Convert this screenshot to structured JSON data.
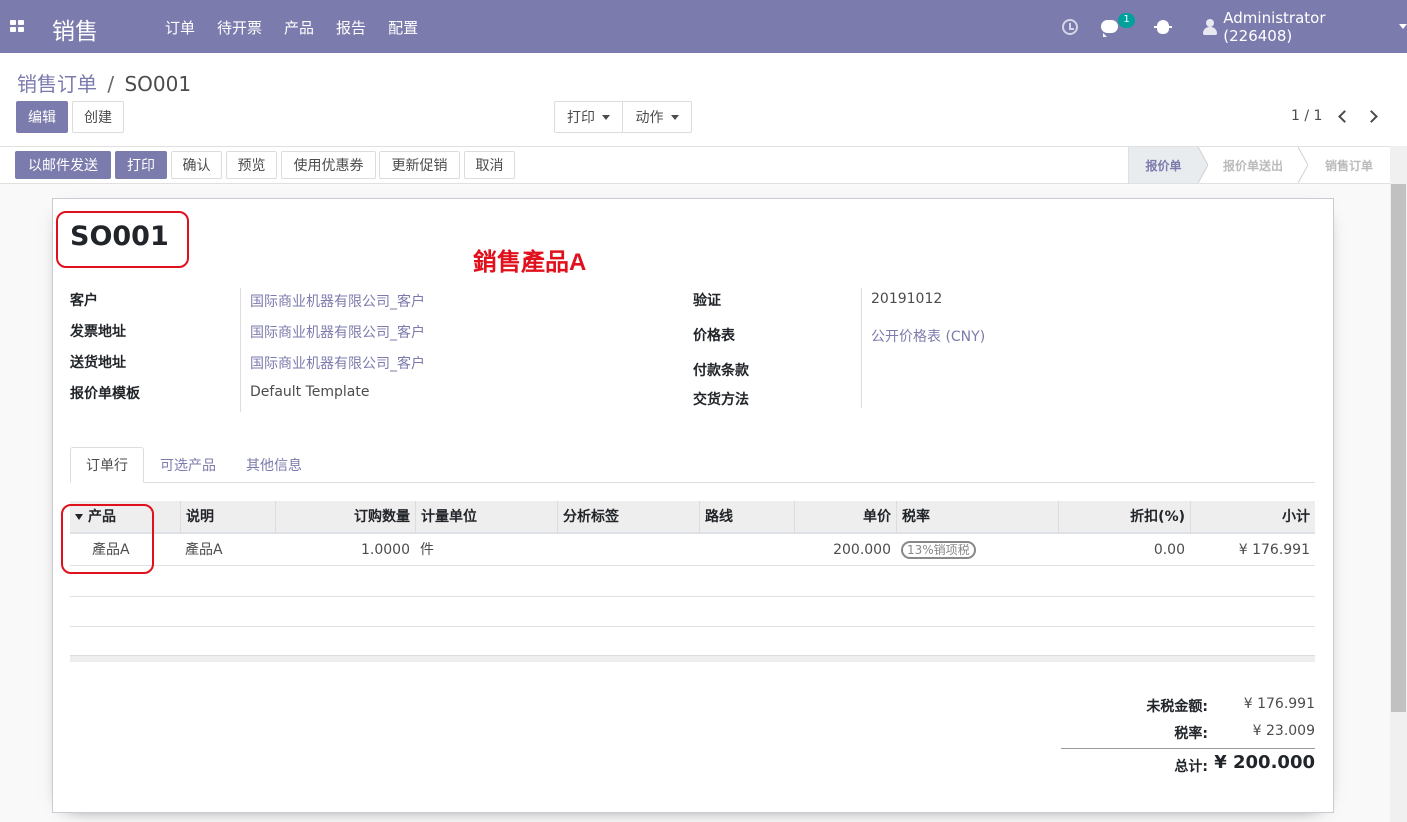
{
  "navbar": {
    "brand": "销售",
    "menu": [
      "订单",
      "待开票",
      "产品",
      "报告",
      "配置"
    ],
    "chat_count": "1",
    "user": "Administrator (226408)"
  },
  "breadcrumb": {
    "parent": "销售订单",
    "separator": "/",
    "current": "SO001"
  },
  "buttons": {
    "edit": "编辑",
    "create": "创建",
    "print": "打印",
    "action": "动作"
  },
  "pager": {
    "value": "1 / 1"
  },
  "statusbar": {
    "buttons": [
      "以邮件发送",
      "打印",
      "确认",
      "预览",
      "使用优惠券",
      "更新促销",
      "取消"
    ],
    "stages": [
      "报价单",
      "报价单送出",
      "销售订单"
    ],
    "active_stage": "报价单"
  },
  "order": {
    "name": "SO001",
    "annotation": "銷售產品A",
    "left_fields": [
      {
        "label": "客户",
        "value": "国际商业机器有限公司_客户"
      },
      {
        "label": "发票地址",
        "value": "国际商业机器有限公司_客户"
      },
      {
        "label": "送货地址",
        "value": "国际商业机器有限公司_客户"
      },
      {
        "label": "报价单模板",
        "value": "Default Template"
      }
    ],
    "right_fields": [
      {
        "label": "验证",
        "value": "20191012"
      },
      {
        "label": "价格表",
        "value": "公开价格表 (CNY)"
      },
      {
        "label": "付款条款",
        "value": ""
      },
      {
        "label": "交货方法",
        "value": ""
      }
    ]
  },
  "tabs": [
    "订单行",
    "可选产品",
    "其他信息"
  ],
  "lines": {
    "headers": [
      "产品",
      "说明",
      "订购数量",
      "计量单位",
      "分析标签",
      "路线",
      "单价",
      "税率",
      "折扣(%)",
      "小计"
    ],
    "rows": [
      {
        "product": "產品A",
        "description": "產品A",
        "qty": "1.0000",
        "uom": "件",
        "analytic": "",
        "route": "",
        "price": "200.000",
        "tax": "13%销项税",
        "discount": "0.00",
        "subtotal": "¥ 176.991"
      }
    ]
  },
  "totals": {
    "untaxed_label": "未税金额:",
    "untaxed": "¥ 176.991",
    "tax_label": "税率:",
    "tax": "¥ 23.009",
    "total_label": "总计:",
    "total": "¥ 200.000"
  },
  "colors": {
    "brand": "#7c7bad",
    "annotation": "#e0101c"
  }
}
